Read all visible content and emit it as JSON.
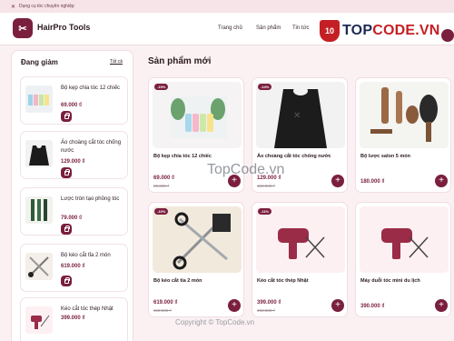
{
  "topbar": {
    "text": "Dụng cụ tóc chuyên nghiệp"
  },
  "header": {
    "brand": "HairPro Tools",
    "nav": [
      "Trang chủ",
      "Sản phẩm",
      "Tin tức"
    ],
    "watermark_logo_left": "TOP",
    "watermark_logo_right": "CODE.VN",
    "watermark_shield": "10"
  },
  "sidebar": {
    "title": "Đang giảm",
    "all_link": "Tất cả",
    "items": [
      {
        "name": "Bộ kẹp chia tóc 12 chiếc",
        "price": "69.000 ₫"
      },
      {
        "name": "Áo choàng cắt tóc chống nước",
        "price": "129.000 ₫"
      },
      {
        "name": "Lược tròn tạo phồng tóc",
        "price": "79.000 ₫"
      },
      {
        "name": "Bộ kéo cắt tỉa 2 món",
        "price": "619.000 ₫"
      },
      {
        "name": "Kéo cắt tóc thép Nhật",
        "price": "399.000 ₫"
      }
    ]
  },
  "main": {
    "title": "Sản phẩm mới",
    "products": [
      {
        "name": "Bộ kẹp chia tóc 12 chiếc",
        "badge": "-19%",
        "price": "69.000 ₫",
        "old_price": "85.000 ₫"
      },
      {
        "name": "Áo choàng cắt tóc chống nước",
        "badge": "-14%",
        "price": "129.000 ₫",
        "old_price": "150.000 ₫"
      },
      {
        "name": "Bộ lược salon 5 món",
        "badge": "",
        "price": "180.000 ₫",
        "old_price": ""
      },
      {
        "name": "Bộ kéo cắt tỉa 2 món",
        "badge": "-10%",
        "price": "619.000 ₫",
        "old_price": "690.000 ₫"
      },
      {
        "name": "Kéo cắt tóc thép Nhật",
        "badge": "-11%",
        "price": "399.000 ₫",
        "old_price": "450.000 ₫"
      },
      {
        "name": "Máy duỗi tóc mini du lịch",
        "badge": "",
        "price": "390.000 ₫",
        "old_price": ""
      }
    ]
  },
  "watermark": {
    "text": "TopCode.vn",
    "footer_text": "Copyright © TopCode.vn"
  },
  "colors": {
    "accent": "#7a1f3d",
    "background": "#fbf1f3"
  },
  "icons": {
    "close": "close-icon",
    "logo": "scissors-icon",
    "cart": "cart-icon",
    "add": "plus-icon"
  }
}
